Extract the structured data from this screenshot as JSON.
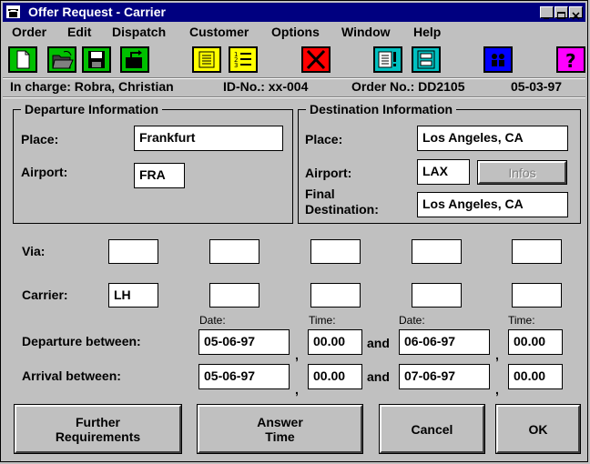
{
  "window": {
    "title": "Offer Request - Carrier"
  },
  "menu": [
    "Order",
    "Edit",
    "Dispatch",
    "Customer",
    "Options",
    "Window",
    "Help"
  ],
  "toolbar": {
    "icons": [
      "new-document-icon",
      "open-folder-icon",
      "save-disk-icon",
      "export-folder-icon",
      "notepad-icon",
      "numbered-list-icon",
      "delete-x-icon",
      "alert-document-icon",
      "form-view-icon",
      "people-icon",
      "help-question-icon"
    ],
    "colors": {
      "green": "#00c000",
      "yellow": "#ffff00",
      "red": "#ff0000",
      "cyan": "#00c0c0",
      "blue": "#0000ff",
      "magenta": "#ff00ff"
    }
  },
  "header": {
    "in_charge": "In charge: Robra, Christian",
    "id_no": "ID-No.: xx-004",
    "order_no": "Order No.: DD2105",
    "date": "05-03-97"
  },
  "departure": {
    "legend": "Departure Information",
    "place_label": "Place:",
    "place_value": "Frankfurt",
    "airport_label": "Airport:",
    "airport_value": "FRA"
  },
  "destination": {
    "legend": "Destination Information",
    "place_label": "Place:",
    "place_value": "Los Angeles, CA",
    "airport_label": "Airport:",
    "airport_value": "LAX",
    "infos_label": "Infos",
    "final_label_1": "Final",
    "final_label_2": "Destination:",
    "final_value": "Los Angeles, CA"
  },
  "routing": {
    "via_label": "Via:",
    "via_values": [
      "",
      "",
      "",
      "",
      ""
    ],
    "carrier_label": "Carrier:",
    "carrier_values": [
      "LH",
      "",
      "",
      "",
      ""
    ]
  },
  "schedule": {
    "date_label": "Date:",
    "time_label": "Time:",
    "and_label": "and",
    "comma": ",",
    "departure_label": "Departure between:",
    "departure": {
      "date1": "05-06-97",
      "time1": "00.00",
      "date2": "06-06-97",
      "time2": "00.00"
    },
    "arrival_label": "Arrival between:",
    "arrival": {
      "date1": "05-06-97",
      "time1": "00.00",
      "date2": "07-06-97",
      "time2": "00.00"
    }
  },
  "buttons": {
    "further_1": "Further",
    "further_2": "Requirements",
    "answer_1": "Answer",
    "answer_2": "Time",
    "cancel": "Cancel",
    "ok": "OK"
  }
}
